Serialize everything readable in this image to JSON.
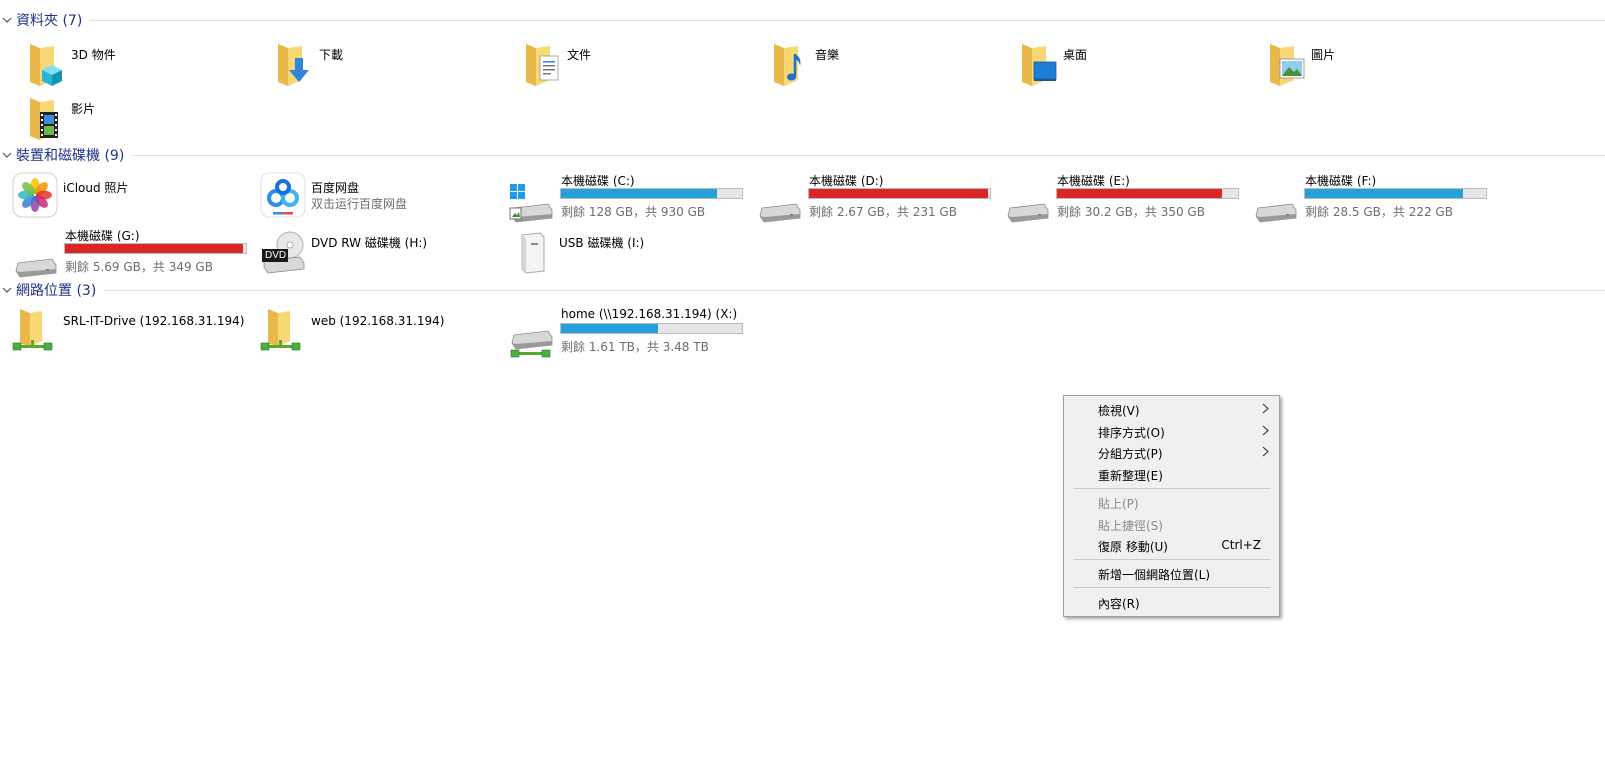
{
  "sections": {
    "folders": {
      "title": "資料夾 (7)"
    },
    "devices": {
      "title": "裝置和磁碟機 (9)"
    },
    "network": {
      "title": "網路位置 (3)"
    }
  },
  "folders": [
    {
      "name": "3D 物件",
      "icon": "3d-objects-folder-icon"
    },
    {
      "name": "下載",
      "icon": "downloads-folder-icon"
    },
    {
      "name": "文件",
      "icon": "documents-folder-icon"
    },
    {
      "name": "音樂",
      "icon": "music-folder-icon"
    },
    {
      "name": "桌面",
      "icon": "desktop-folder-icon"
    },
    {
      "name": "圖片",
      "icon": "pictures-folder-icon"
    },
    {
      "name": "影片",
      "icon": "videos-folder-icon"
    }
  ],
  "devices": {
    "icloud": {
      "name": "iCloud 照片"
    },
    "baidu": {
      "name": "百度网盘",
      "sub": "双击运行百度网盘"
    },
    "c": {
      "name": "本機磁碟 (C:)",
      "sub": "剩餘 128 GB，共 930 GB",
      "used_fraction": 0.862,
      "color": "#26a0da"
    },
    "d": {
      "name": "本機磁碟 (D:)",
      "sub": "剩餘 2.67 GB，共 231 GB",
      "used_fraction": 0.988,
      "color": "#da2626"
    },
    "e": {
      "name": "本機磁碟 (E:)",
      "sub": "剩餘 30.2 GB，共 350 GB",
      "used_fraction": 0.914,
      "color": "#da2626"
    },
    "f": {
      "name": "本機磁碟 (F:)",
      "sub": "剩餘 28.5 GB，共 222 GB",
      "used_fraction": 0.872,
      "color": "#26a0da"
    },
    "g": {
      "name": "本機磁碟 (G:)",
      "sub": "剩餘 5.69 GB，共 349 GB",
      "used_fraction": 0.984,
      "color": "#da2626"
    },
    "h": {
      "name": "DVD RW 磁碟機 (H:)",
      "badge": "DVD"
    },
    "i": {
      "name": "USB 磁碟機 (I:)"
    }
  },
  "network": {
    "srl": {
      "name": "SRL-IT-Drive (192.168.31.194)"
    },
    "web": {
      "name": "web (192.168.31.194)"
    },
    "home": {
      "name": "home (\\\\192.168.31.194) (X:)",
      "sub": "剩餘 1.61 TB，共 3.48 TB",
      "used_fraction": 0.537,
      "color": "#26a0da"
    }
  },
  "context_menu": {
    "view": "檢視(V)",
    "sort": "排序方式(O)",
    "group": "分組方式(P)",
    "refresh": "重新整理(E)",
    "paste": "貼上(P)",
    "paste_shortcut": "貼上捷徑(S)",
    "undo": "復原 移動(U)",
    "undo_shortcut": "Ctrl+Z",
    "add_network": "新增一個網路位置(L)",
    "properties": "內容(R)"
  }
}
